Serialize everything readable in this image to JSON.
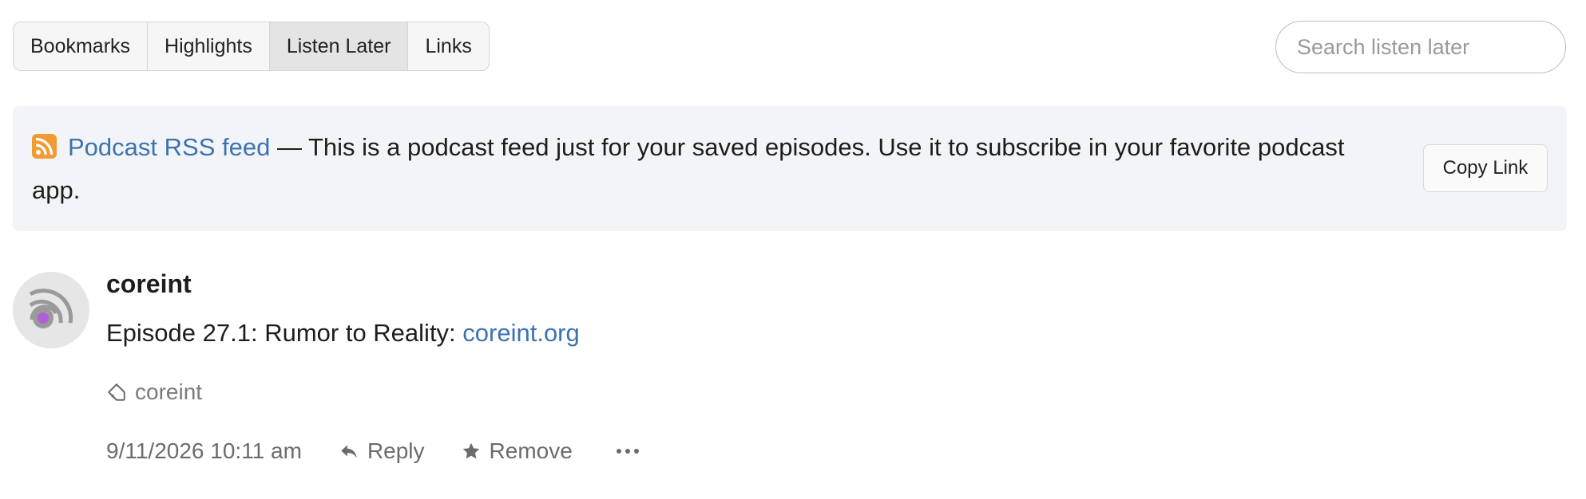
{
  "tabs": [
    {
      "label": "Bookmarks",
      "active": false
    },
    {
      "label": "Highlights",
      "active": false
    },
    {
      "label": "Listen Later",
      "active": true
    },
    {
      "label": "Links",
      "active": false
    }
  ],
  "search": {
    "placeholder": "Search listen later",
    "value": ""
  },
  "banner": {
    "icon": "rss-icon",
    "link_text": "Podcast RSS feed",
    "description": " — This is a podcast feed just for your saved episodes. Use it to subscribe in your favorite podcast app.",
    "copy_label": "Copy Link"
  },
  "post": {
    "author": "coreint",
    "title_text": "Episode 27.1: Rumor to Reality: ",
    "title_link": "coreint.org",
    "tag": "coreint",
    "timestamp": "9/11/2026 10:11 am",
    "reply_label": "Reply",
    "remove_label": "Remove",
    "more_icon": "more-icon"
  },
  "colors": {
    "link": "#3b73b0",
    "rss": "#f29b34",
    "avatar_dot": "#b05fd6"
  }
}
